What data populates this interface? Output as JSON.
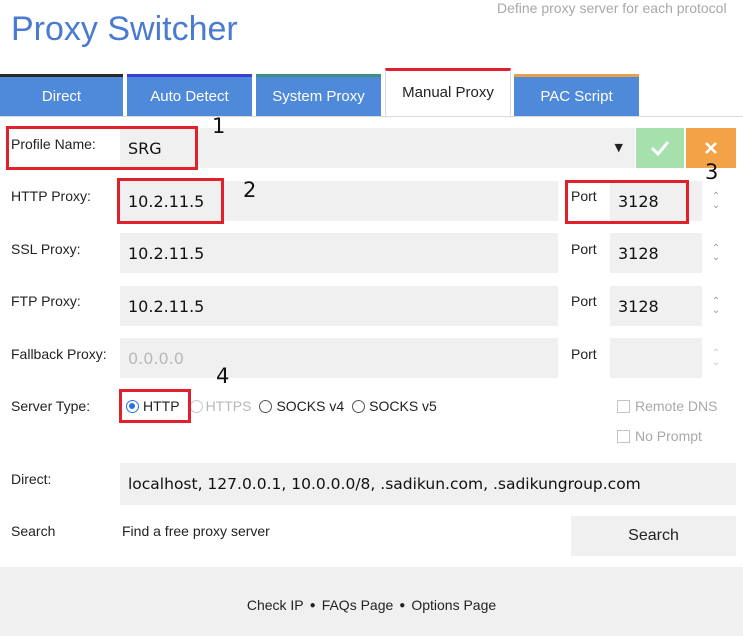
{
  "header": {
    "title": "Proxy Switcher",
    "subtitle": "Define proxy server for each protocol"
  },
  "tabs": [
    {
      "label": "Direct",
      "accent": "#2b2b2b"
    },
    {
      "label": "Auto Detect",
      "accent": "#3a3fd6"
    },
    {
      "label": "System Proxy",
      "accent": "#3e8e84"
    },
    {
      "label": "Manual Proxy",
      "accent": "#e0202a",
      "active": true
    },
    {
      "label": "PAC Script",
      "accent": "#e6a04a"
    }
  ],
  "profile": {
    "label": "Profile Name:",
    "value": "SRG",
    "confirm_icon": "check-icon",
    "cancel_icon": "close-icon",
    "confirm_color": "#a6e0ad",
    "cancel_color": "#f2a348"
  },
  "http": {
    "label": "HTTP Proxy:",
    "value": "10.2.11.5",
    "port_label": "Port",
    "port": "3128"
  },
  "ssl": {
    "label": "SSL Proxy:",
    "value": "10.2.11.5",
    "port_label": "Port",
    "port": "3128"
  },
  "ftp": {
    "label": "FTP Proxy:",
    "value": "10.2.11.5",
    "port_label": "Port",
    "port": "3128"
  },
  "fallback": {
    "label": "Fallback Proxy:",
    "placeholder": "0.0.0.0",
    "port_label": "Port",
    "port": ""
  },
  "server_type": {
    "label": "Server Type:",
    "options": [
      "HTTP",
      "HTTPS",
      "SOCKS v4",
      "SOCKS v5"
    ],
    "selected": "HTTP",
    "remote_dns": "Remote DNS",
    "no_prompt": "No Prompt"
  },
  "direct": {
    "label": "Direct:",
    "value": "localhost, 127.0.0.1, 10.0.0.0/8, .sadikun.com, .sadikungroup.com"
  },
  "search": {
    "label": "Search",
    "text": "Find a free proxy server",
    "button": "Search"
  },
  "footer": {
    "links": [
      "Check IP",
      "FAQs Page",
      "Options Page"
    ],
    "separator": "●"
  },
  "annotations": [
    "1",
    "2",
    "3",
    "4"
  ],
  "colors": {
    "accent_blue": "#4e8ad9",
    "highlight_red": "#e0202a"
  }
}
